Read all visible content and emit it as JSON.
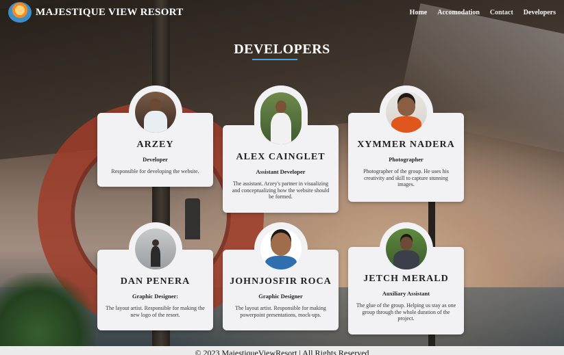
{
  "header": {
    "brand": "MAJESTIQUE VIEW RESORT",
    "nav": [
      {
        "label": "Home"
      },
      {
        "label": "Accomodation"
      },
      {
        "label": "Contact"
      },
      {
        "label": "Developers"
      }
    ]
  },
  "section": {
    "title": "DEVELOPERS"
  },
  "developers": [
    {
      "name": "ARZEY",
      "role": "Developer",
      "description": "Responsible for developing the website."
    },
    {
      "name": "ALEX CAINGLET",
      "role": "Assistant Developer",
      "description": "The assistant. Arzey's partner in visualizing and conceptualizing how the website should be formed."
    },
    {
      "name": "XYMMER NADERA",
      "role": "Photographer",
      "description": "Photographer of the group. He uses his creativity and skill to capture stunning images."
    },
    {
      "name": "DAN PENERA",
      "role": "Graphic Designer:",
      "description": "The layout artist. Responsible for making the new logo of the resort."
    },
    {
      "name": "JOHNJOSFIR ROCA",
      "role": "Graphic Designer",
      "description": "The layout artist. Responsible for making powerpoint presentations, mock-ups."
    },
    {
      "name": "JETCH MERALD",
      "role": "Auxiliary Assistant",
      "description": "The glue of the group. Helping us stay as one group through the whole duration of the project."
    }
  ],
  "footer": {
    "text": "© 2023 MajestiqueViewResort | All Rights Reserved"
  },
  "colors": {
    "accent_underline": "#4fa3d9",
    "card_bg": "#f2f2f5",
    "header_text": "#ffffff"
  }
}
